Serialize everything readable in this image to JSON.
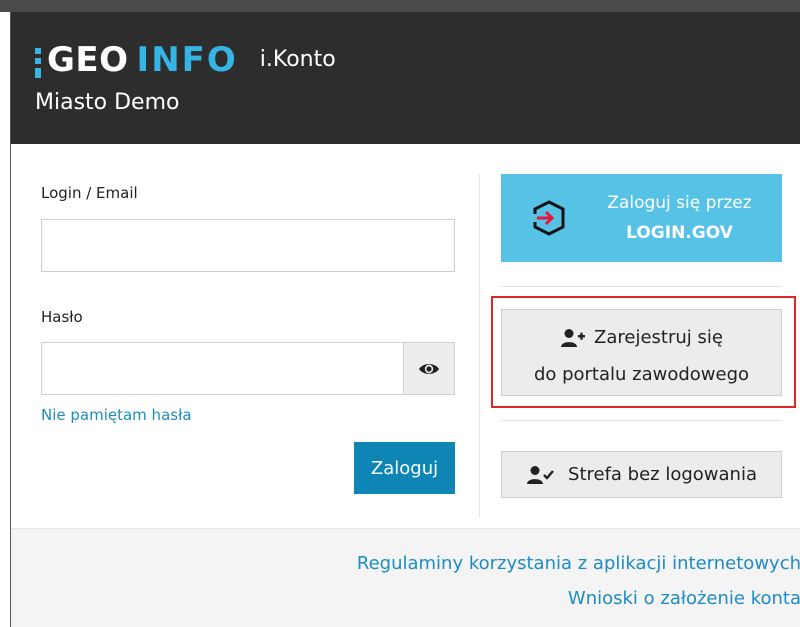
{
  "header": {
    "logo_geo": "GEO",
    "logo_info": "INFO",
    "app_name": "i.Konto",
    "city": "Miasto Demo"
  },
  "form": {
    "login_label": "Login / Email",
    "login_value": "",
    "password_label": "Hasło",
    "password_value": "",
    "show_password_icon": "eye-icon",
    "forgot_link": "Nie pamiętam hasła",
    "submit_label": "Zaloguj"
  },
  "side": {
    "gov_line1": "Zaloguj się przez",
    "gov_line2": "LOGIN.GOV",
    "gov_icon": "login-gov-icon",
    "register_line1": "Zarejestruj się",
    "register_line2": "do portalu zawodowego",
    "register_icon": "user-plus-icon",
    "nologin_label": "Strefa bez logowania",
    "nologin_icon": "user-check-icon"
  },
  "footer": {
    "link1": "Regulaminy korzystania z aplikacji internetowych",
    "link2": "Wnioski o założenie konta"
  },
  "colors": {
    "header_bg": "#2d2d2d",
    "accent": "#35b4e6",
    "submit_bg": "#0d86b6",
    "gov_bg": "#55c2e6",
    "highlight": "#e02424",
    "link": "#1c8cc3"
  }
}
